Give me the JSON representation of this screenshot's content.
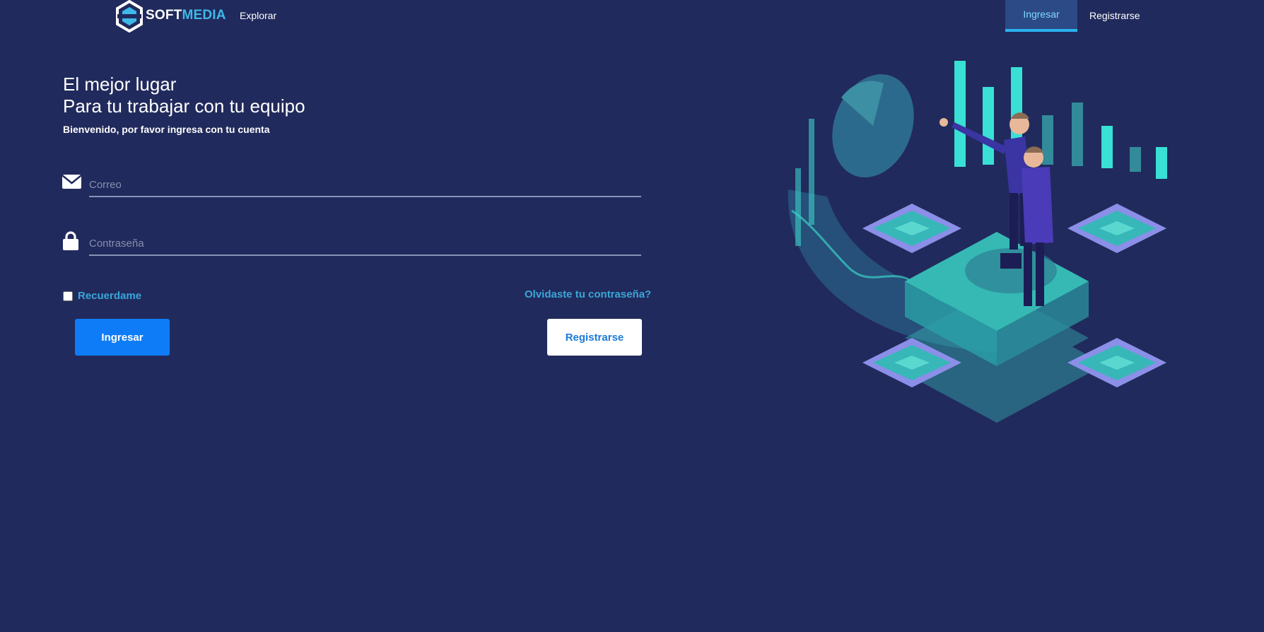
{
  "header": {
    "logo_soft": "SOFT",
    "logo_media": "MEDIA",
    "explore_label": "Explorar",
    "login_tab": "Ingresar",
    "register_tab": "Registrarse"
  },
  "hero": {
    "line1": "El mejor lugar",
    "line2": "Para tu trabajar con tu equipo",
    "subtitle": "Bienvenido, por favor ingresa con tu cuenta"
  },
  "form": {
    "email_placeholder": "Correo",
    "email_icon": "envelope-icon",
    "password_placeholder": "Contraseña",
    "password_icon": "lock-icon",
    "remember_label": "Recuerdame",
    "forgot_label": "Olvidaste tu contraseña?",
    "login_button": "Ingresar",
    "register_button": "Registrarse"
  },
  "colors": {
    "background": "#212a5c",
    "accent": "#3aa6d8",
    "primary_button": "#0f7cf7"
  }
}
